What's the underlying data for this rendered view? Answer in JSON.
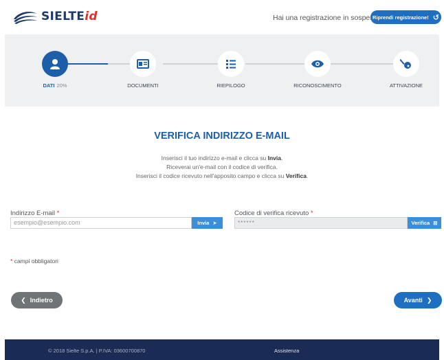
{
  "header": {
    "logo_text": "SIELTE",
    "logo_suffix": "id",
    "pending_question": "Hai una registrazione in sospeso?",
    "resume_label": "Riprendi registrazione!"
  },
  "steps": [
    {
      "label": "DATI",
      "pct": "20%",
      "icon": "user-icon"
    },
    {
      "label": "DOCUMENTI",
      "icon": "id-card-icon"
    },
    {
      "label": "RIEPILOGO",
      "icon": "list-icon"
    },
    {
      "label": "RICONOSCIMENTO",
      "icon": "eye-icon"
    },
    {
      "label": "ATTIVAZIONE",
      "icon": "key-icon"
    }
  ],
  "progress": {
    "current_step": 1,
    "percent": 20
  },
  "main": {
    "title": "VERIFICA INDIRIZZO E-MAIL",
    "line1_pre": "Inserisci il tuo indirizzo e-mail e clicca su ",
    "line1_bold": "Invia",
    "line1_post": ".",
    "line2": "Riceverai un'e-mail con il codice di verifica.",
    "line3_pre": "Inserisci il codice ricevuto nell'apposito campo e clicca su ",
    "line3_bold": "Verifica",
    "line3_post": "."
  },
  "form": {
    "email_label": "Indirizzo E-mail",
    "email_placeholder": "esempio@esempio.com",
    "send_label": "Invia",
    "code_label": "Codice di verifica ricevuto",
    "code_placeholder": "******",
    "verify_label": "Verifica",
    "required_mark": "*",
    "required_note": "campi obbligatori"
  },
  "nav": {
    "back_label": "Indietro",
    "next_label": "Avanti"
  },
  "footer": {
    "copyright": "© 2018 Sielte S.p.A. | P.IVA: 03600700870",
    "help": "Assistenza"
  },
  "colors": {
    "primary": "#1f6fc1",
    "step_active": "#1c5ea8",
    "footer_bg": "#1a2b55",
    "required": "#e03030"
  }
}
